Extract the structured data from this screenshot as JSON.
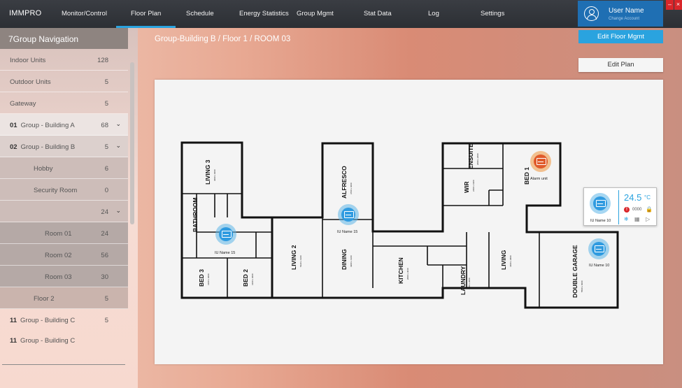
{
  "app": {
    "logo_a": "IMM",
    "logo_b": "PRO"
  },
  "nav": {
    "items": [
      {
        "label": "Monitor/Control"
      },
      {
        "label": "Floor Plan"
      },
      {
        "label": "Schedule"
      },
      {
        "label": "Energy Statistics"
      },
      {
        "label": "Group Mgmt"
      },
      {
        "label": "Stat Data"
      },
      {
        "label": "Log"
      },
      {
        "label": "Settings"
      }
    ],
    "active": "Floor Plan"
  },
  "user": {
    "name": "User Name",
    "sub": "Change Account"
  },
  "window": {
    "minimize": "–",
    "close": "×"
  },
  "actions": {
    "edit_floor": "Edit Floor Mgmt",
    "edit_plan": "Edit Plan"
  },
  "sidebar": {
    "title": "7Group Navigation",
    "rows": [
      {
        "index": "",
        "label": "Indoor Units",
        "count": "128"
      },
      {
        "index": "",
        "label": "Outdoor Units",
        "count": "5"
      },
      {
        "index": "",
        "label": "Gateway",
        "count": "5"
      },
      {
        "index": "01",
        "label": "Group - Building A",
        "count": "68"
      },
      {
        "index": "02",
        "label": "Group - Building B",
        "count": "5"
      },
      {
        "index": "",
        "label": "Hobby",
        "count": "6"
      },
      {
        "index": "",
        "label": "Security Room",
        "count": "0"
      },
      {
        "index": "",
        "label": "",
        "count": "24"
      },
      {
        "index": "",
        "label": "Room 01",
        "count": "24"
      },
      {
        "index": "",
        "label": "Room 02",
        "count": "56"
      },
      {
        "index": "",
        "label": "Room 03",
        "count": "30"
      },
      {
        "index": "",
        "label": "Floor 2",
        "count": "5"
      },
      {
        "index": "11",
        "label": "Group - Building C",
        "count": "5"
      },
      {
        "index": "11",
        "label": "Group - Building C",
        "count": ""
      }
    ]
  },
  "breadcrumb": "Group-Building B / Floor 1 / ROOM 03",
  "floorplan": {
    "rooms": {
      "living3": "LIVING 3",
      "bathroom": "BATHROOM",
      "bed3": "BED 3",
      "bed2": "BED 2",
      "living2": "LIVING 2",
      "alfresco": "ALFRESCO",
      "dining": "DINING",
      "kitchen": "KITCHEN",
      "laundry": "LAUNDRY",
      "living": "LIVING",
      "wir": "WIR",
      "ensuite": "ENSUITE",
      "bed1": "BED 1",
      "garage": "DOUBLE GARAGE"
    },
    "units": [
      {
        "label": "IU Name 15",
        "status": "normal"
      },
      {
        "label": "IU Name 15",
        "status": "normal"
      },
      {
        "label": "Alarm unit",
        "status": "alarm"
      },
      {
        "label": "IU Name 10",
        "status": "normal"
      },
      {
        "label": "IU Name 10",
        "status": "normal"
      }
    ]
  },
  "popup": {
    "temperature": "24.5",
    "unit": "°C",
    "error_code": "0000",
    "label": "IU Name 10"
  }
}
